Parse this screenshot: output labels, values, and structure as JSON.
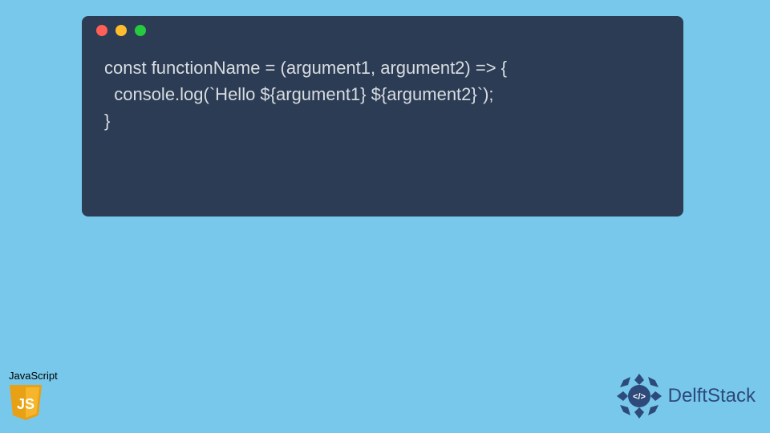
{
  "window": {
    "dots": [
      "red",
      "yellow",
      "green"
    ]
  },
  "code": {
    "line1": "const functionName = (argument1, argument2) => {",
    "line2": "  console.log(`Hello ${argument1} ${argument2}`);",
    "line3": "}"
  },
  "js_badge": {
    "label": "JavaScript",
    "logo_text": "JS"
  },
  "brand": {
    "name": "DelftStack",
    "symbol": "</>"
  },
  "colors": {
    "background": "#78c8eb",
    "window_bg": "#2b3c54",
    "code_text": "#d9dde2",
    "js_yellow": "#f7a81b",
    "brand_blue": "#2d4a7a"
  }
}
